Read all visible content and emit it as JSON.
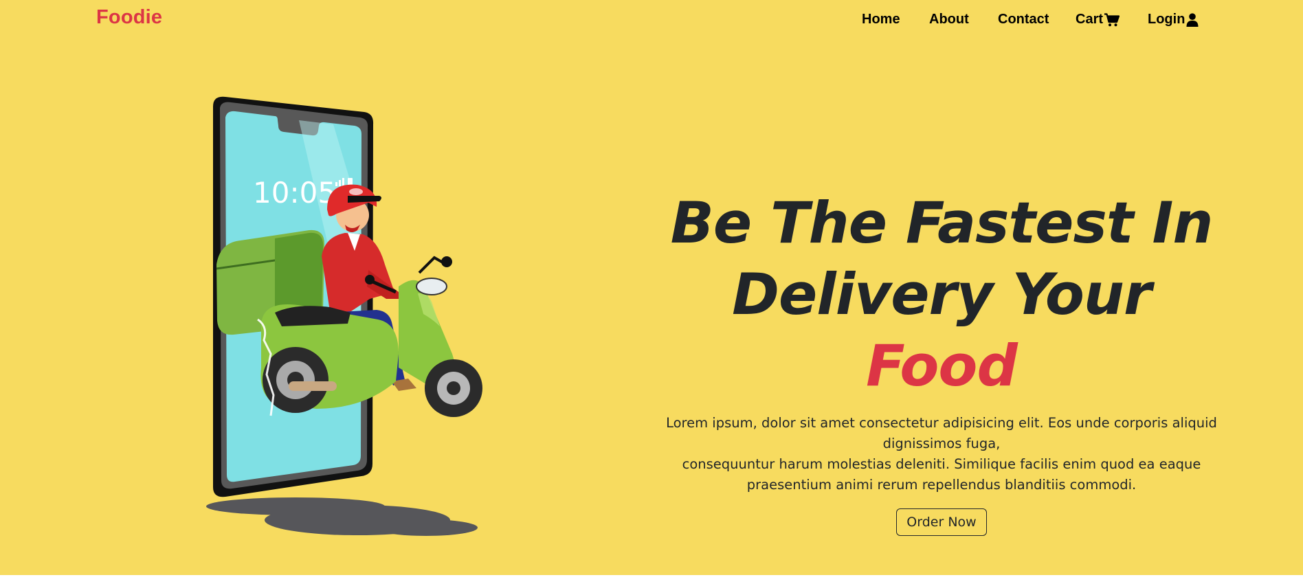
{
  "brand": {
    "name": "Foodie",
    "color": "#dc3545"
  },
  "nav": {
    "home": "Home",
    "about": "About",
    "contact": "Contact",
    "cart": "Cart",
    "cart_icon": "cart-icon",
    "login": "Login",
    "login_icon": "user-icon"
  },
  "hero": {
    "headline_line1": "Be The Fastest In",
    "headline_line2": "Delivery Your",
    "headline_accent": "Food",
    "description_line1": "Lorem ipsum, dolor sit amet consectetur adipisicing elit. Eos unde corporis aliquid dignissimos fuga,",
    "description_line2": "consequuntur harum molestias deleniti. Similique facilis enim quod ea eaque praesentium animi rerum repellendus blanditiis commodi.",
    "cta_label": "Order Now",
    "illustration": {
      "name": "delivery-scooter-phone-illustration",
      "phone_time": "10:05"
    }
  },
  "colors": {
    "background": "#f7db5f",
    "accent": "#dc3545",
    "text": "#212529",
    "scooter": "#8cc63f",
    "screen": "#7fe0e4"
  }
}
